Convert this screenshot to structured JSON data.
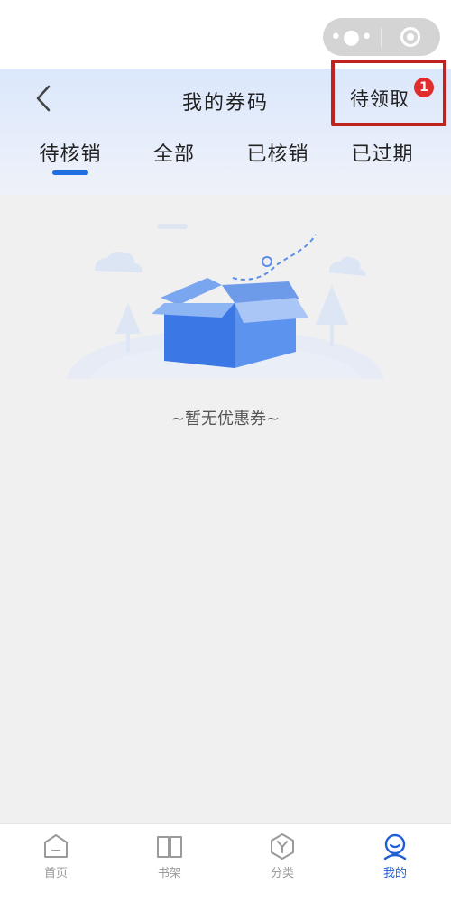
{
  "header": {
    "title": "我的券码",
    "pending_label": "待领取",
    "pending_badge": "1"
  },
  "tabs": [
    {
      "label": "待核销",
      "active": true
    },
    {
      "label": "全部",
      "active": false
    },
    {
      "label": "已核销",
      "active": false
    },
    {
      "label": "已过期",
      "active": false
    }
  ],
  "empty_state": {
    "text": "~暂无优惠券~"
  },
  "bottom_nav": [
    {
      "label": "首页",
      "icon": "home-icon",
      "active": false
    },
    {
      "label": "书架",
      "icon": "bookshelf-icon",
      "active": false
    },
    {
      "label": "分类",
      "icon": "category-icon",
      "active": false
    },
    {
      "label": "我的",
      "icon": "profile-icon",
      "active": true
    }
  ],
  "colors": {
    "accent": "#1f6fe0",
    "badge": "#e02e2e",
    "highlight_border": "#c0231f",
    "nav_active": "#1f5fd6",
    "nav_inactive": "#9a9a9a"
  }
}
